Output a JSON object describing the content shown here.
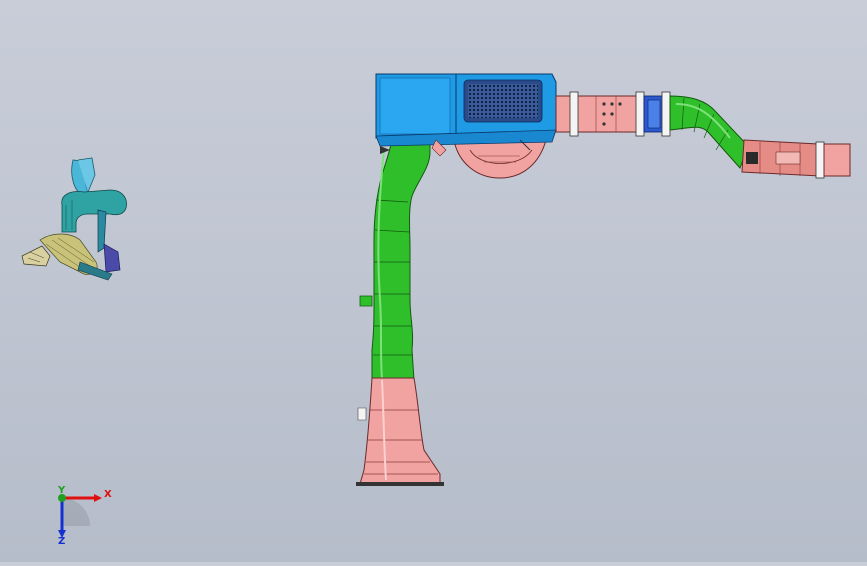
{
  "viewport": {
    "background_top": "#c8cdd8",
    "background_bottom": "#b6bdca"
  },
  "parts": [
    {
      "name": "blower-housing",
      "color": "#1f9be6"
    },
    {
      "name": "vertical-duct",
      "color": "#2fbf2a"
    },
    {
      "name": "floor-outlet",
      "color": "#f0a3a0"
    },
    {
      "name": "horizontal-duct",
      "color": "#f0a3a0"
    },
    {
      "name": "duct-elbow",
      "color": "#2fbf2a"
    },
    {
      "name": "duct-end-outlet",
      "color": "#e58c86"
    },
    {
      "name": "preview-assembly",
      "color": "#2fa3a3"
    }
  ],
  "triad": {
    "x_label": "X",
    "y_label": "Y",
    "z_label": "Z",
    "x_color": "#e01010",
    "y_color": "#20a020",
    "z_color": "#1530d0"
  }
}
